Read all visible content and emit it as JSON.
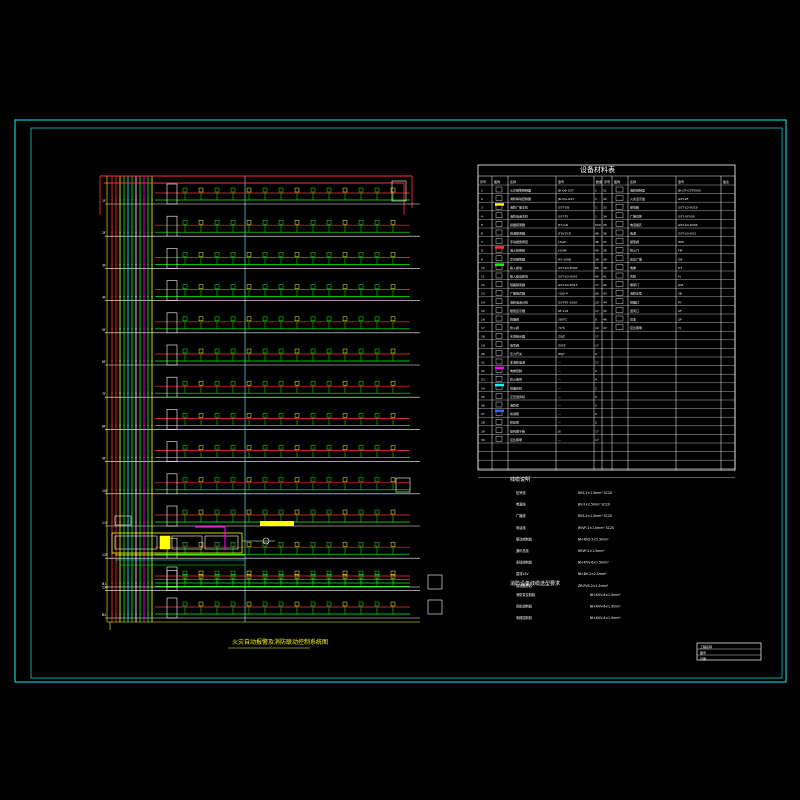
{
  "drawing": {
    "title": "火灾自动报警及消防联动控制系统图",
    "table_title": "设备材料表",
    "notes_title": "线缆说明",
    "floor_tags": [
      "1F",
      "2F",
      "3F",
      "4F",
      "5F",
      "6F",
      "7F",
      "8F",
      "9F",
      "10F",
      "11F",
      "12F",
      "13F",
      "14F",
      "15F"
    ],
    "floor_count": 15,
    "basement_tags": [
      "B1",
      "B2"
    ],
    "table_columns": [
      "序号",
      "图例",
      "名称",
      "型号",
      "数量",
      "序号",
      "图例",
      "名称",
      "型号",
      "备注"
    ],
    "table_rows": [
      {
        "no": "1",
        "name": "火灾报警控制器",
        "model": "JB-QB-GST",
        "qty": "1"
      },
      {
        "no": "2",
        "name": "消防联动控制器",
        "model": "JB-QG-GST",
        "qty": "1"
      },
      {
        "no": "3",
        "name": "消防广播主机",
        "model": "GST-GB",
        "qty": "1"
      },
      {
        "no": "4",
        "name": "消防电话主机",
        "model": "GST-TS",
        "qty": "1"
      },
      {
        "no": "5",
        "name": "感烟探测器",
        "model": "JTY-GD",
        "qty": "520"
      },
      {
        "no": "6",
        "name": "感温探测器",
        "model": "JTW-ZCD",
        "qty": "48"
      },
      {
        "no": "7",
        "name": "手动报警按钮",
        "model": "J-SAP",
        "qty": "36"
      },
      {
        "no": "8",
        "name": "消火栓按钮",
        "model": "J-SAM",
        "qty": "40"
      },
      {
        "no": "9",
        "name": "声光报警器",
        "model": "HX-100B",
        "qty": "36"
      },
      {
        "no": "10",
        "name": "输入模块",
        "model": "GST-LD-8300",
        "qty": "60"
      },
      {
        "no": "11",
        "name": "输入输出模块",
        "model": "GST-LD-8301",
        "qty": "45"
      },
      {
        "no": "12",
        "name": "短路隔离器",
        "model": "GST-LD-8313",
        "qty": "17"
      },
      {
        "no": "13",
        "name": "广播扬声器",
        "model": "YXJ3-4",
        "qty": "90"
      },
      {
        "no": "14",
        "name": "消防电话分机",
        "model": "GST-TS-100A",
        "qty": "20"
      },
      {
        "no": "15",
        "name": "楼层显示器",
        "model": "ZF-101",
        "qty": "17"
      },
      {
        "no": "16",
        "name": "排烟阀",
        "model": "280℃",
        "qty": "8"
      },
      {
        "no": "17",
        "name": "防火阀",
        "model": "70℃",
        "qty": "12"
      },
      {
        "no": "18",
        "name": "水流指示器",
        "model": "ZSJZ",
        "qty": "17"
      },
      {
        "no": "19",
        "name": "信号阀",
        "model": "ZSFZ",
        "qty": "17"
      },
      {
        "no": "20",
        "name": "压力开关",
        "model": "ZSJY",
        "qty": "2"
      },
      {
        "no": "21",
        "name": "非消防电源",
        "model": "—",
        "qty": "17"
      },
      {
        "no": "22",
        "name": "电梯控制",
        "model": "—",
        "qty": "2"
      },
      {
        "no": "23",
        "name": "防火卷帘",
        "model": "—",
        "qty": "4"
      },
      {
        "no": "24",
        "name": "排烟风机",
        "model": "—",
        "qty": "2"
      },
      {
        "no": "25",
        "name": "正压送风机",
        "model": "—",
        "qty": "2"
      },
      {
        "no": "26",
        "name": "消防泵",
        "model": "—",
        "qty": "2"
      },
      {
        "no": "27",
        "name": "喷淋泵",
        "model": "—",
        "qty": "2"
      },
      {
        "no": "28",
        "name": "稳压泵",
        "model": "—",
        "qty": "2"
      },
      {
        "no": "29",
        "name": "接线端子箱",
        "model": "JX",
        "qty": "17"
      },
      {
        "no": "30",
        "name": "应急照明",
        "model": "—",
        "qty": "17"
      }
    ],
    "right_rows": [
      {
        "no": "31",
        "name": "消防控制室",
        "model": "JB-QT-GST5000"
      },
      {
        "no": "32",
        "name": "火灾显示盘",
        "model": "GST-ZF"
      },
      {
        "no": "33",
        "name": "模块箱",
        "model": "GST-LD-8319"
      },
      {
        "no": "34",
        "name": "广播切换",
        "model": "GST-GF500"
      },
      {
        "no": "35",
        "name": "电话插孔",
        "model": "GST-LD-8304"
      },
      {
        "no": "36",
        "name": "电源",
        "model": "GST-LD-D02"
      },
      {
        "no": "37",
        "name": "报警阀",
        "model": "ZSS"
      },
      {
        "no": "38",
        "name": "防火门",
        "model": "FM"
      },
      {
        "no": "39",
        "name": "应急广播",
        "model": "GB"
      },
      {
        "no": "40",
        "name": "电梯",
        "model": "DT"
      },
      {
        "no": "41",
        "name": "风机",
        "model": "FJ"
      },
      {
        "no": "42",
        "name": "卷帘门",
        "model": "JLM"
      },
      {
        "no": "43",
        "name": "消防水泵",
        "model": "SB"
      },
      {
        "no": "44",
        "name": "排烟口",
        "model": "PY"
      },
      {
        "no": "45",
        "name": "送风口",
        "model": "SF"
      },
      {
        "no": "46",
        "name": "切非",
        "model": "QF"
      },
      {
        "no": "47",
        "name": "应急照明",
        "model": "YJ"
      }
    ],
    "notes": [
      {
        "label": "信号线",
        "spec": "RVS-2×1.5mm² SC20"
      },
      {
        "label": "电源线",
        "spec": "BV-2×2.5mm² SC20"
      },
      {
        "label": "广播线",
        "spec": "RVS-2×1.5mm² SC20"
      },
      {
        "label": "电话线",
        "spec": "RVVP-2×1.0mm² SC20"
      },
      {
        "label": "联动控制线",
        "spec": "NH-RVS-2×1.5mm²"
      },
      {
        "label": "通讯总线",
        "spec": "RVVP-2×1.5mm²"
      },
      {
        "label": "多线控制线",
        "spec": "NH-KVV-6×1.5mm²"
      },
      {
        "label": "直流24V",
        "spec": "NH-BV-2×2.5mm²"
      },
      {
        "label": "探测器总线",
        "spec": "ZR-RVS-2×1.5mm²"
      }
    ],
    "notes2_title": "消防设备线缆选型要求",
    "notes2": [
      {
        "label": "消防泵控制线",
        "spec": "NH-KVV-6×1.5mm²"
      },
      {
        "label": "风机控制线",
        "spec": "NH-KVV-6×1.5mm²"
      },
      {
        "label": "电梯控制线",
        "spec": "NH-KVV-4×1.5mm²"
      }
    ],
    "title_block": [
      "工程名称",
      "图号",
      "日期"
    ],
    "colors": {
      "border": "#00ffff",
      "green": "#00ff00",
      "red": "#ff3333",
      "yellow": "#ffff00",
      "magenta": "#ff00ff",
      "white": "#ffffff",
      "cyan": "#00ffff",
      "blue": "#3366ff"
    }
  }
}
